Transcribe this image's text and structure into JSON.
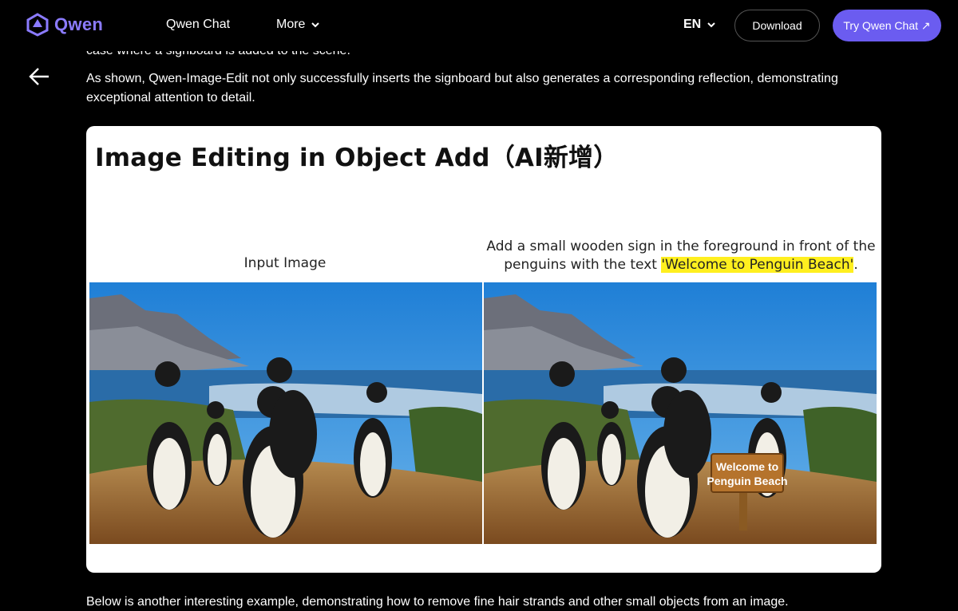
{
  "header": {
    "logo_text": "Qwen",
    "nav_chat": "Qwen Chat",
    "nav_more": "More",
    "lang": "EN",
    "download_label": "Download",
    "try_label": "Try Qwen Chat ↗"
  },
  "article": {
    "para_cut": "case where a signboard is added to the scene.",
    "para_main": "As shown, Qwen-Image-Edit not only successfully inserts the signboard but also generates a corresponding reflection, demonstrating exceptional attention to detail.",
    "para_bottom": "Below is another interesting example, demonstrating how to remove fine hair strands and other small objects from an image."
  },
  "card": {
    "title": "Image Editing in Object Add（AI新增）",
    "caption_left": "Input Image",
    "caption_right_pre": "Add a small wooden sign in the foreground in front of the penguins with the text ",
    "caption_right_highlight": "'Welcome to Penguin Beach'",
    "caption_right_post": ".",
    "sign_line1": "Welcome to",
    "sign_line2": "Penguin Beach"
  },
  "colors": {
    "accent": "#6b5cf0",
    "logo": "#8b7bff",
    "highlight": "#ffef1f"
  }
}
